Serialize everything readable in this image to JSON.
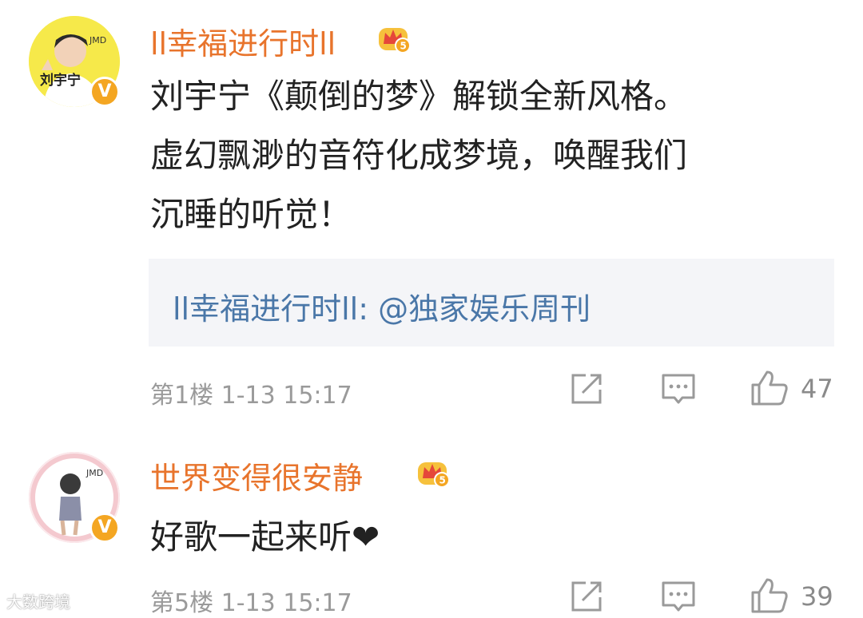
{
  "comments": [
    {
      "username": "ll幸福进行时ll",
      "avatar_caption": "刘宇宁",
      "avatar_tag": "JMD",
      "verified_badge": "V",
      "member_level": "5",
      "text_lines": [
        "刘宇宁《颠倒的梦》解锁全新风格。",
        "虚幻飘渺的音符化成梦境，唤醒我们",
        "沉睡的听觉！"
      ],
      "quote": "ll幸福进行时ll: @独家娱乐周刊",
      "floor": "第1楼",
      "time": "1-13 15:17",
      "likes": "47",
      "icons": [
        "share-icon",
        "reply-icon",
        "like-icon"
      ]
    },
    {
      "username": "世界变得很安静",
      "avatar_tag": "JMD",
      "verified_badge": "V",
      "member_level": "5",
      "text_lines": [
        "好歌一起来听❤"
      ],
      "floor": "第5楼",
      "time": "1-13 15:17",
      "likes": "39",
      "icons": [
        "share-icon",
        "reply-icon",
        "like-icon"
      ]
    }
  ],
  "watermark": "大数跨境",
  "colors": {
    "username": "#e8742c",
    "quote_link": "#4a77a8",
    "meta": "#9a9a9a",
    "badge": "#f4a622"
  }
}
